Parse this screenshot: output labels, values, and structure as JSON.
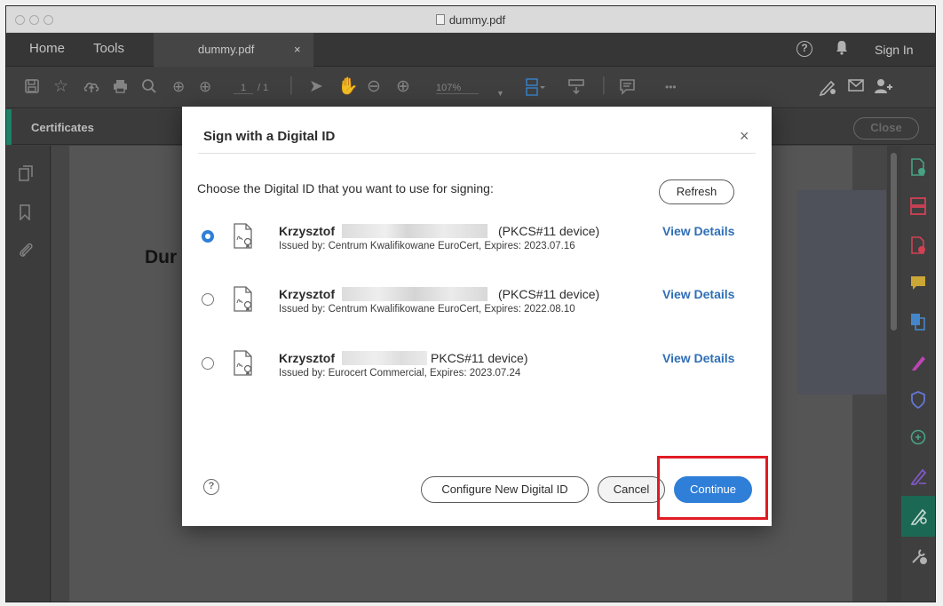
{
  "window": {
    "title": "dummy.pdf"
  },
  "tabs": {
    "home": "Home",
    "tools": "Tools",
    "document": "dummy.pdf",
    "document_close": "×",
    "sign_in": "Sign In",
    "help_glyph": "?"
  },
  "toolbar": {
    "page_current": "1",
    "page_total": "/ 1",
    "zoom": "107%",
    "more": "•••"
  },
  "panel": {
    "label": "Certificates",
    "close_label": "Close"
  },
  "document": {
    "heading": "Dur"
  },
  "dialog": {
    "title": "Sign with a Digital ID",
    "close_glyph": "×",
    "prompt": "Choose the Digital ID that you want to use for signing:",
    "refresh_label": "Refresh",
    "ids": [
      {
        "name": "Krzysztof",
        "device": "(PKCS#11 device)",
        "issuer": "Issued by: Centrum Kwalifikowane EuroCert, Expires: 2023.07.16",
        "selected": true,
        "details_label": "View Details"
      },
      {
        "name": "Krzysztof",
        "device": "(PKCS#11 device)",
        "issuer": "Issued by: Centrum Kwalifikowane EuroCert, Expires: 2022.08.10",
        "selected": false,
        "details_label": "View Details"
      },
      {
        "name": "Krzysztof",
        "device": "PKCS#11 device)",
        "issuer": "Issued by: Eurocert Commercial, Expires: 2023.07.24",
        "selected": false,
        "details_label": "View Details"
      }
    ],
    "help_glyph": "?",
    "configure_label": "Configure New Digital ID",
    "cancel_label": "Cancel",
    "continue_label": "Continue"
  },
  "colors": {
    "accent": "#2f7ed8",
    "link": "#2f6eb5",
    "highlight": "#e01b24",
    "panel_accent": "#1f8a6e"
  }
}
